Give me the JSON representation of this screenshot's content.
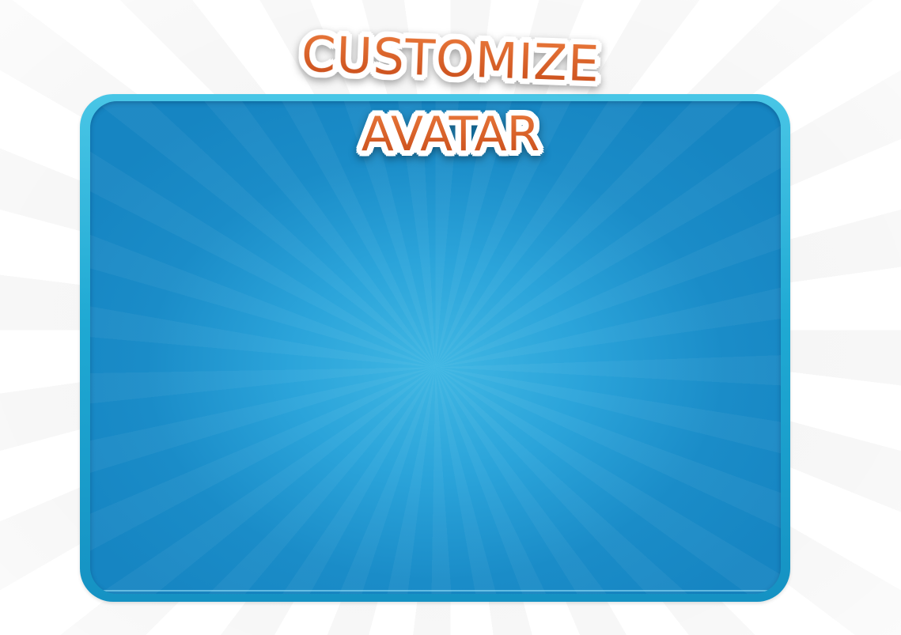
{
  "screen": {
    "title_line_1": "CUSTOMIZE",
    "title_line_2": "AVATAR"
  },
  "colors": {
    "title_text": "#d35a22",
    "title_outline": "#ffffff",
    "panel_border": "#2fb6df",
    "panel_fill": "#1a8cc8",
    "panel_glow": "#40b7e3",
    "background": "#ffffff",
    "background_rays": "#f3f3f3"
  }
}
